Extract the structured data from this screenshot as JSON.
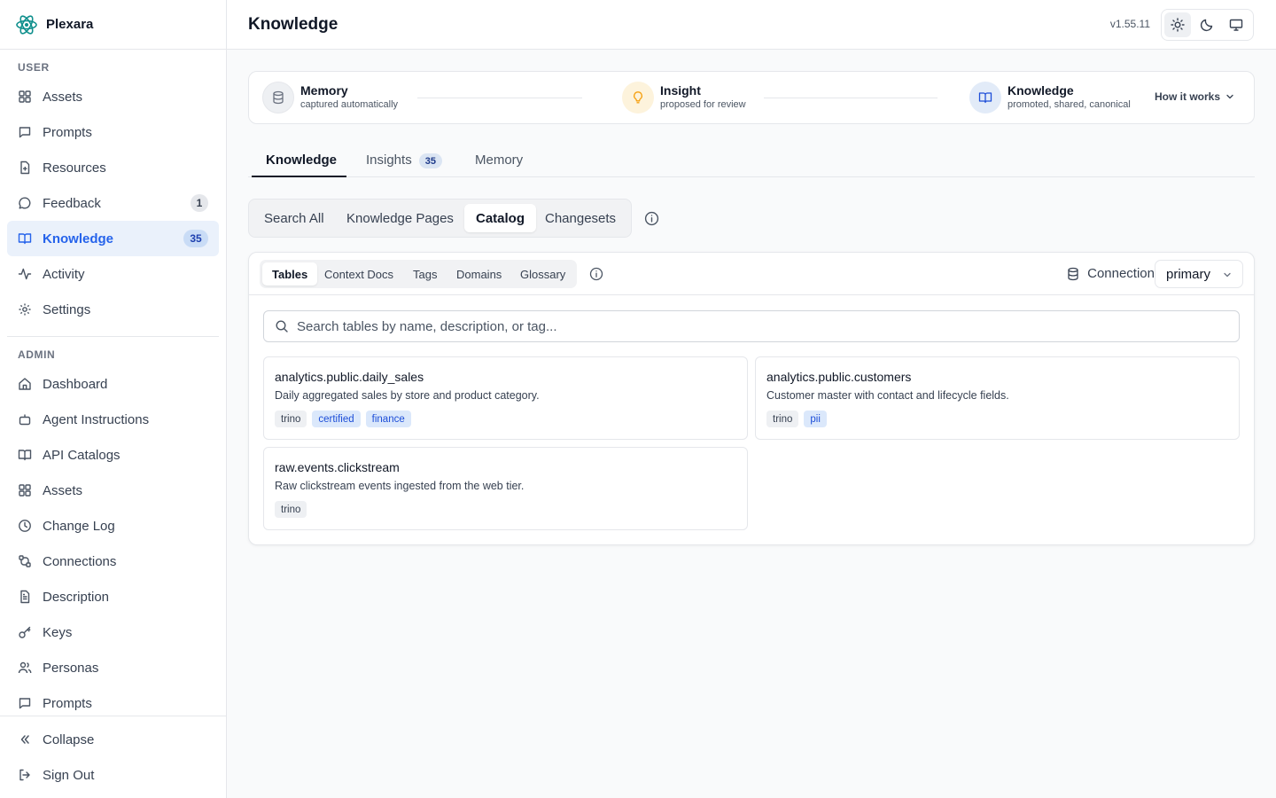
{
  "app": {
    "name": "Plexara",
    "version": "v1.55.11"
  },
  "page": {
    "title": "Knowledge"
  },
  "sidebar": {
    "user_section": {
      "title": "USER",
      "items": [
        {
          "label": "Assets",
          "icon": "grid-icon"
        },
        {
          "label": "Prompts",
          "icon": "message-square-icon"
        },
        {
          "label": "Resources",
          "icon": "file-plus-icon"
        },
        {
          "label": "Feedback",
          "icon": "message-circle-icon",
          "badge": "1"
        },
        {
          "label": "Knowledge",
          "icon": "book-open-icon",
          "badge": "35",
          "active": true
        },
        {
          "label": "Activity",
          "icon": "activity-icon"
        },
        {
          "label": "Settings",
          "icon": "gear-icon"
        }
      ]
    },
    "admin_section": {
      "title": "ADMIN",
      "items": [
        {
          "label": "Dashboard",
          "icon": "home-icon"
        },
        {
          "label": "Agent Instructions",
          "icon": "bot-icon"
        },
        {
          "label": "API Catalogs",
          "icon": "book-open-icon"
        },
        {
          "label": "Assets",
          "icon": "grid-icon"
        },
        {
          "label": "Change Log",
          "icon": "clock-icon"
        },
        {
          "label": "Connections",
          "icon": "cable-icon"
        },
        {
          "label": "Description",
          "icon": "file-text-icon"
        },
        {
          "label": "Keys",
          "icon": "key-icon"
        },
        {
          "label": "Personas",
          "icon": "users-icon"
        },
        {
          "label": "Prompts",
          "icon": "message-square-icon"
        }
      ]
    },
    "footer": {
      "collapse_label": "Collapse",
      "signout_label": "Sign Out"
    }
  },
  "theme_switch": {
    "options": [
      "light",
      "dark",
      "system"
    ],
    "selected": "light"
  },
  "pipeline": {
    "stages": [
      {
        "title": "Memory",
        "subtitle": "captured automatically",
        "icon": "database-icon",
        "color": "#eef0f3"
      },
      {
        "title": "Insight",
        "subtitle": "proposed for review",
        "icon": "lightbulb-icon",
        "color": "#fdf3dc"
      },
      {
        "title": "Knowledge",
        "subtitle": "promoted, shared, canonical",
        "icon": "book-open-icon",
        "color": "#e2ebf8"
      }
    ],
    "how_it_works_label": "How it works"
  },
  "tabs": [
    {
      "label": "Knowledge",
      "active": true
    },
    {
      "label": "Insights",
      "count": "35"
    },
    {
      "label": "Memory"
    }
  ],
  "segments": {
    "items": [
      "Search All",
      "Knowledge Pages",
      "Catalog",
      "Changesets"
    ],
    "selected": "Catalog"
  },
  "catalog": {
    "subtabs": [
      "Tables",
      "Context Docs",
      "Tags",
      "Domains",
      "Glossary"
    ],
    "selected_subtab": "Tables",
    "connection_label": "Connection",
    "connection_value": "primary",
    "search_placeholder": "Search tables by name, description, or tag...",
    "tables": [
      {
        "name": "analytics.public.daily_sales",
        "description": "Daily aggregated sales by store and product category.",
        "tags": [
          {
            "label": "trino",
            "style": "neutral"
          },
          {
            "label": "certified",
            "style": "blue"
          },
          {
            "label": "finance",
            "style": "blue"
          }
        ]
      },
      {
        "name": "analytics.public.customers",
        "description": "Customer master with contact and lifecycle fields.",
        "tags": [
          {
            "label": "trino",
            "style": "neutral"
          },
          {
            "label": "pii",
            "style": "blue"
          }
        ]
      },
      {
        "name": "raw.events.clickstream",
        "description": "Raw clickstream events ingested from the web tier.",
        "tags": [
          {
            "label": "trino",
            "style": "neutral"
          }
        ]
      }
    ]
  },
  "colors": {
    "accent": "#2563eb",
    "active_bg": "#eaf1fb",
    "insight": "#f59e0b"
  }
}
